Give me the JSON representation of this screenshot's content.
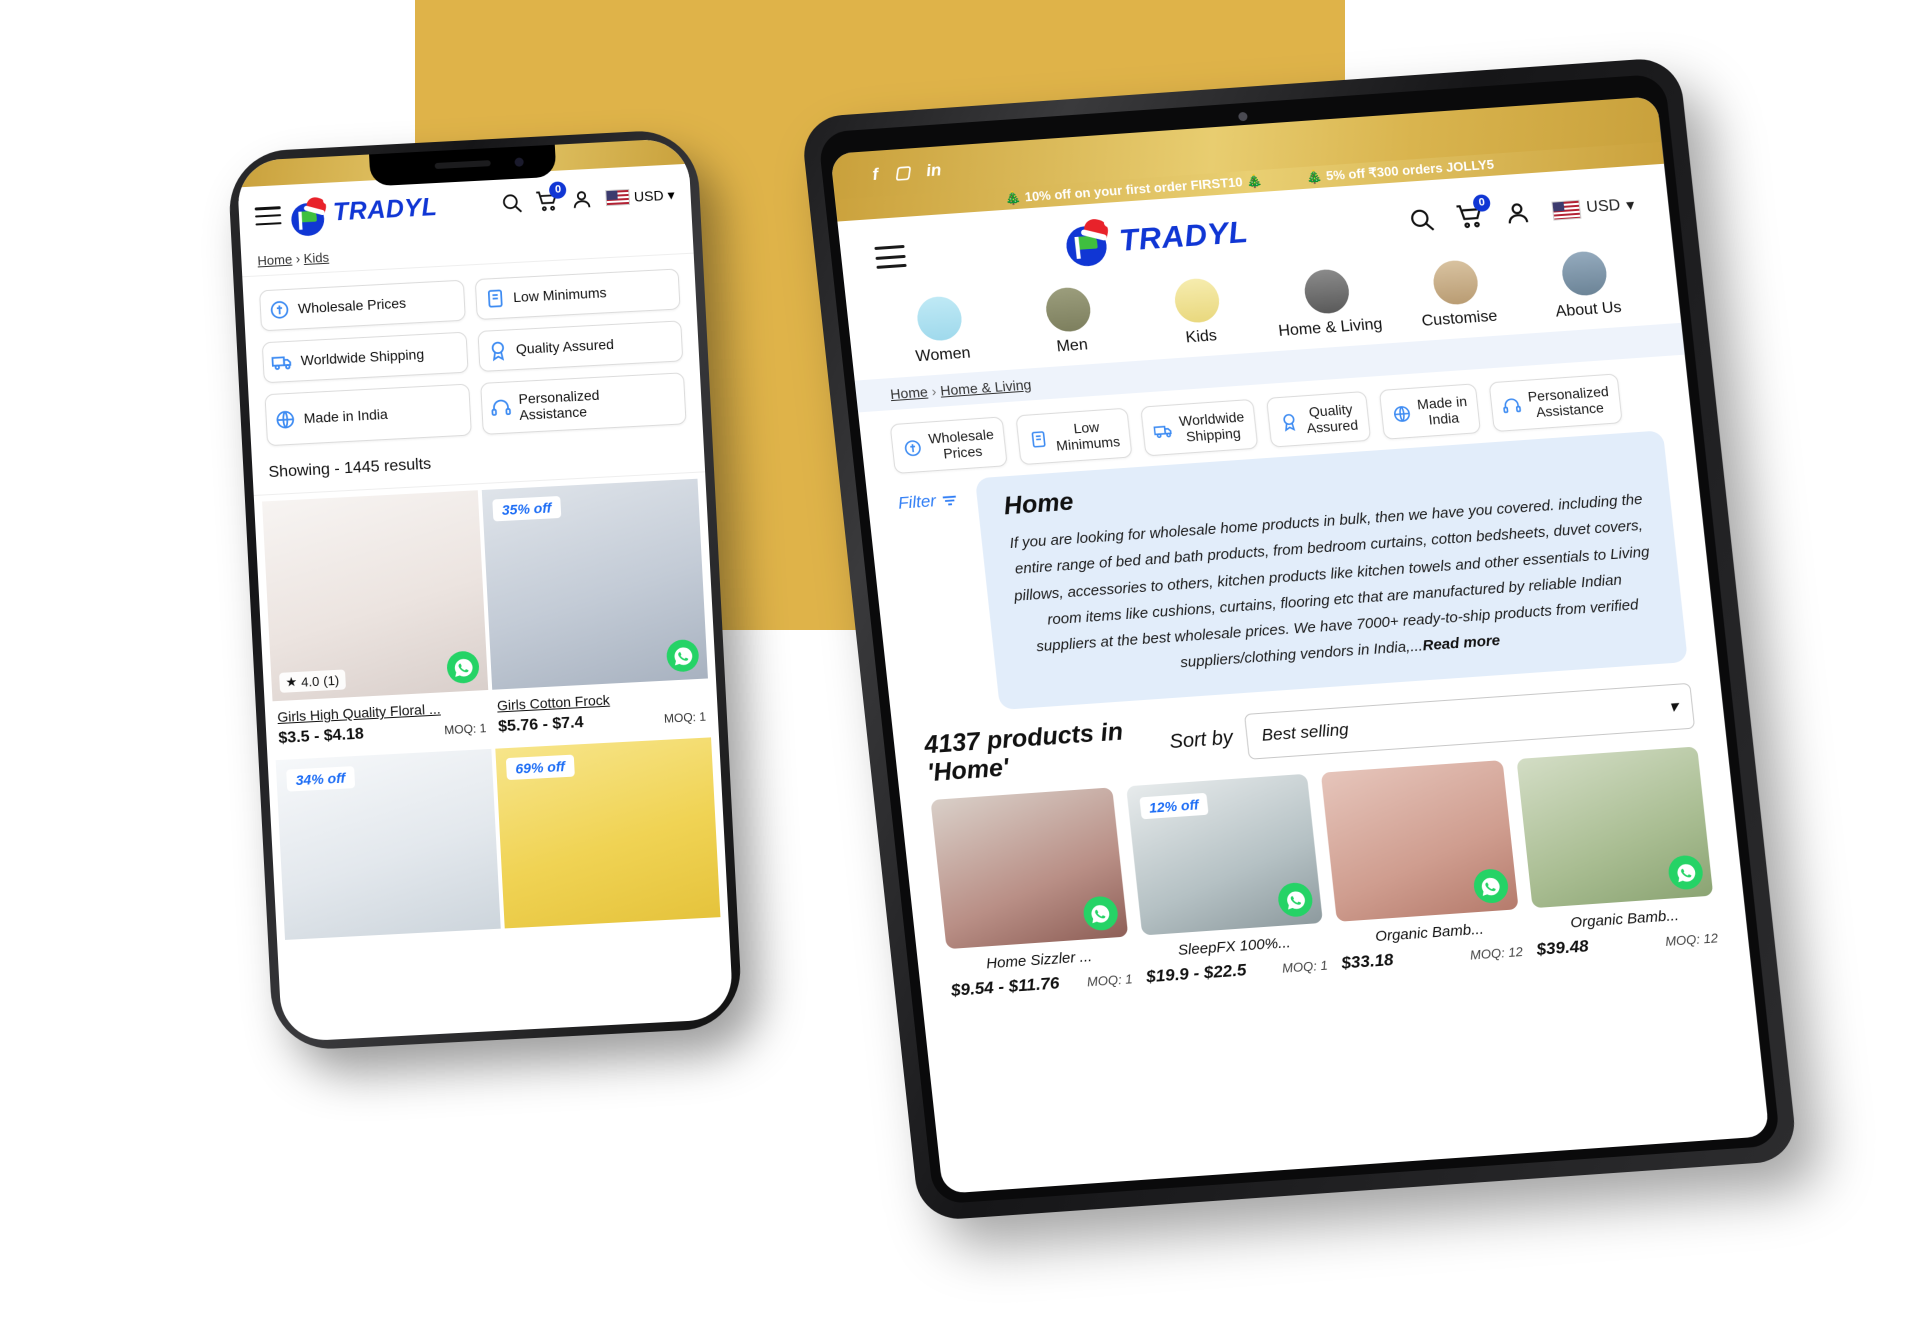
{
  "brand": {
    "name": "TRADYL",
    "logo_colors": {
      "blue": "#1036d4",
      "green": "#3fbf3f",
      "hat_red": "#e8222a"
    },
    "accent": "#2f7df5"
  },
  "tablet": {
    "social": [
      "f",
      "▢",
      "in"
    ],
    "promo": [
      {
        "icon": "🎄",
        "text": "10% off on your first order  FIRST10"
      },
      {
        "icon": "🎄",
        "text": "5% off ₹300 orders  JOLLY5"
      }
    ],
    "header": {
      "menu": "menu-icon",
      "search": "search-icon",
      "cart_count": "0",
      "account": "account-icon",
      "currency": "USD"
    },
    "nav": [
      {
        "label": "Women",
        "bg": "#bfe9f5"
      },
      {
        "label": "Men",
        "bg": "#8d8f6c"
      },
      {
        "label": "Kids",
        "bg": "#f2e398"
      },
      {
        "label": "Home & Living",
        "bg": "#6f6f6f"
      },
      {
        "label": "Customise",
        "bg": "#cbb48f"
      },
      {
        "label": "About Us",
        "bg": "#7c93a8"
      }
    ],
    "breadcrumb": {
      "root": "Home",
      "sep": "›",
      "current": "Home & Living"
    },
    "badges": [
      {
        "label": "Wholesale\nPrices",
        "icon": "tag-icon"
      },
      {
        "label": "Low\nMinimums",
        "icon": "clipboard-icon"
      },
      {
        "label": "Worldwide\nShipping",
        "icon": "truck-icon"
      },
      {
        "label": "Quality\nAssured",
        "icon": "award-icon"
      },
      {
        "label": "Made in\nIndia",
        "icon": "globe-icon"
      },
      {
        "label": "Personalized\nAssistance",
        "icon": "headset-icon"
      }
    ],
    "filter_label": "Filter",
    "description": {
      "title": "Home",
      "body": "If you are looking for wholesale home products in bulk, then we have you covered. including the entire range of bed and bath products, from bedroom curtains, cotton bedsheets, duvet covers, pillows, accessories to others, kitchen products like kitchen towels and other essentials to Living room items like cushions, curtains, flooring etc that are manufactured by reliable Indian suppliers at the best wholesale prices. We have 7000+ ready-to-ship products from verified suppliers/clothing vendors in India,...",
      "read_more": "Read more"
    },
    "results": {
      "count_text": "4137 products in 'Home'",
      "sort_label": "Sort by",
      "sort_value": "Best selling"
    },
    "products": [
      {
        "title": "Home Sizzler ...",
        "price": "$9.54 - $11.76",
        "moq": "MOQ: 1",
        "discount": "",
        "bg": "#c9a9a1"
      },
      {
        "title": "SleepFX 100%...",
        "price": "$19.9 - $22.5",
        "moq": "MOQ: 1",
        "discount": "12% off",
        "bg": "#b9c3c6"
      },
      {
        "title": "Organic Bamb...",
        "price": "$33.18",
        "moq": "MOQ: 12",
        "discount": "",
        "bg": "#d8a99b"
      },
      {
        "title": "Organic Bamb...",
        "price": "$39.48",
        "moq": "MOQ: 12",
        "discount": "",
        "bg": "#aebb9a"
      }
    ]
  },
  "phone": {
    "header": {
      "cart_count": "0",
      "currency": "USD"
    },
    "breadcrumb": {
      "root": "Home",
      "sep": "›",
      "current": "Kids"
    },
    "badges": [
      {
        "label": "Wholesale Prices",
        "icon": "tag-icon"
      },
      {
        "label": "Low Minimums",
        "icon": "clipboard-icon"
      },
      {
        "label": "Worldwide Shipping",
        "icon": "truck-icon"
      },
      {
        "label": "Quality Assured",
        "icon": "award-icon"
      },
      {
        "label": "Made in India",
        "icon": "globe-icon"
      },
      {
        "label": "Personalized\nAssistance",
        "icon": "headset-icon"
      }
    ],
    "showing": "Showing - 1445 results",
    "products": [
      {
        "title": "Girls High Quality Floral ...",
        "price": "$3.5 - $4.18",
        "moq": "MOQ: 1",
        "discount": "",
        "rating": "4.0",
        "reviews": "(1)",
        "bg": "#f0ecea"
      },
      {
        "title": "Girls Cotton Frock",
        "price": "$5.76 - $7.4",
        "moq": "MOQ: 1",
        "discount": "35% off",
        "rating": "",
        "reviews": "",
        "bg": "#c7cdd6"
      },
      {
        "title": "",
        "price": "",
        "moq": "",
        "discount": "34% off",
        "rating": "",
        "reviews": "",
        "bg": "#eceff2"
      },
      {
        "title": "",
        "price": "",
        "moq": "",
        "discount": "69% off",
        "rating": "",
        "reviews": "",
        "bg": "#f3d969"
      }
    ]
  }
}
